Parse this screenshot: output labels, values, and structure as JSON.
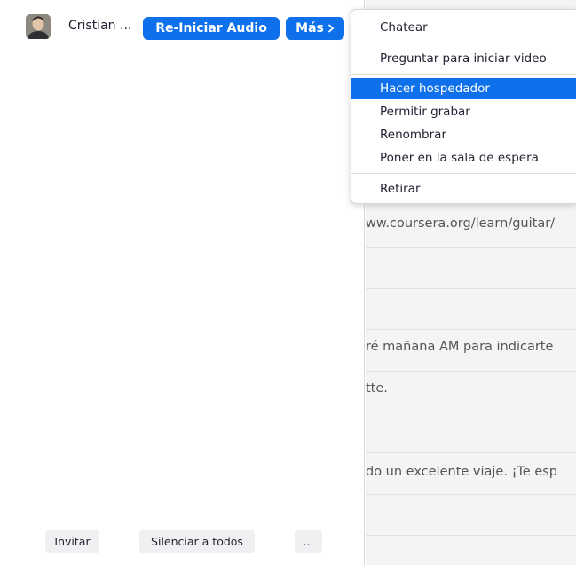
{
  "participant": {
    "name": "Cristian ...",
    "restart_audio_label": "Re-Iniciar Audio",
    "more_label": "Más",
    "more_icon": "chevron-right-icon"
  },
  "footer": {
    "invite_label": "Invitar",
    "mute_all_label": "Silenciar a todos",
    "more_options_label": "..."
  },
  "menu": {
    "items": [
      "Chatear",
      "Preguntar para iniciar video",
      "Hacer hospedador",
      "Permitir grabar",
      "Renombrar",
      "Poner en la sala de espera",
      "Retirar"
    ],
    "highlighted_item": "Hacer hospedador"
  },
  "chat": {
    "lines": [
      "ww.coursera.org/learn/guitar/",
      "ré mañana AM para indicarte",
      "tte.",
      "do un excelente viaje. ¡Te esp"
    ]
  },
  "colors": {
    "accent": "#0e71eb",
    "chat_background": "#f4f4f4"
  }
}
